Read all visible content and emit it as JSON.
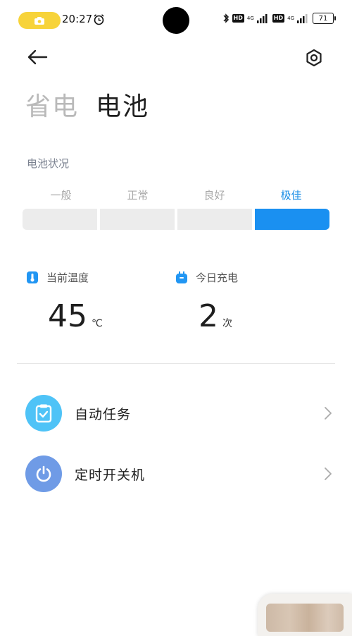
{
  "status_bar": {
    "time": "20:27",
    "hd_1": "HD",
    "hd_2": "HD",
    "net_1": "4G",
    "net_2": "4G",
    "battery": "71"
  },
  "header": {
    "tabs": [
      {
        "label": "省电",
        "active": false
      },
      {
        "label": "电池",
        "active": true
      }
    ]
  },
  "battery_status": {
    "label": "电池状况",
    "levels": [
      "一般",
      "正常",
      "良好",
      "极佳"
    ],
    "current_level": "极佳"
  },
  "stats": {
    "temperature": {
      "label": "当前温度",
      "value": "45",
      "unit": "℃"
    },
    "charges_today": {
      "label": "今日充电",
      "value": "2",
      "unit": "次"
    }
  },
  "menu": [
    {
      "label": "自动任务",
      "icon": "clipboard-check-icon"
    },
    {
      "label": "定时开关机",
      "icon": "power-icon"
    }
  ],
  "colors": {
    "accent": "#1a90f1",
    "rec_pill": "#f7d33a",
    "auto_task_icon": "#4fc3f7",
    "power_icon": "#6f9be6"
  }
}
